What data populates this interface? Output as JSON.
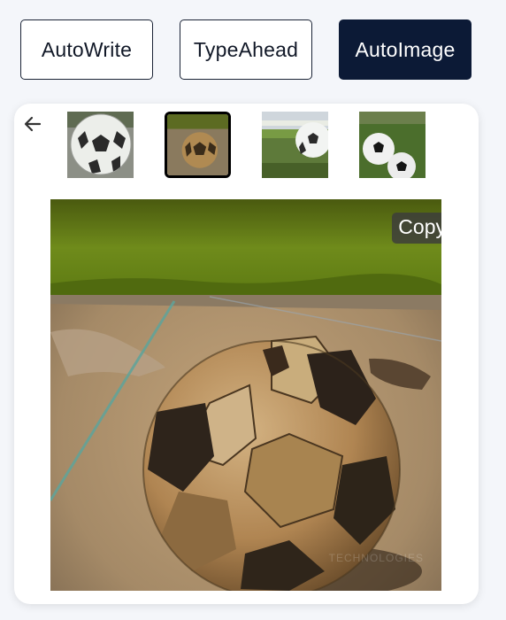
{
  "tabs": [
    {
      "label": "AutoWrite",
      "active": false
    },
    {
      "label": "TypeAhead",
      "active": false
    },
    {
      "label": "AutoImage",
      "active": true
    }
  ],
  "gallery": {
    "back_icon": "arrow-left-icon",
    "thumbnails": [
      {
        "subject": "soccer ball on concrete",
        "selected": false
      },
      {
        "subject": "worn soccer ball",
        "selected": true
      },
      {
        "subject": "soccer ball on field",
        "selected": false
      },
      {
        "subject": "soccer balls in grass",
        "selected": false
      }
    ],
    "copy_label": "Copy",
    "watermark": "TECHNOLOGIES"
  },
  "colors": {
    "active_tab": "#0c1a36",
    "background": "#f4f6fa",
    "copy_button": "#3c3c3c"
  }
}
